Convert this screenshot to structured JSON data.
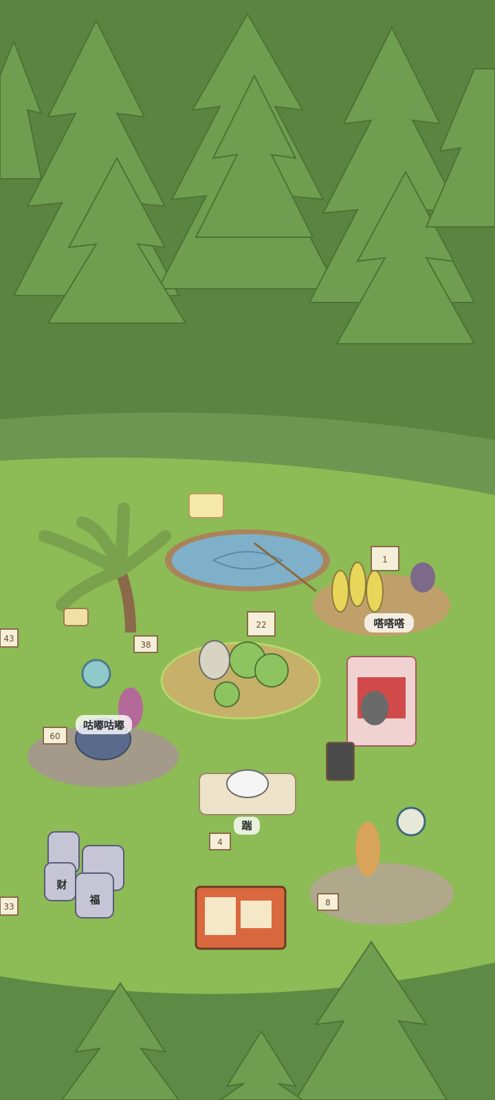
{
  "scene": {
    "name": "forest camp"
  },
  "labels": {
    "station_numbers": [
      "43",
      "38",
      "22",
      "1",
      "60",
      "4",
      "8",
      "33"
    ],
    "sounds": {
      "pot_bubbling": "咕嘟咕嘟",
      "chopping": "嗒嗒嗒",
      "kick": "踹"
    },
    "jars": [
      "财",
      "福"
    ]
  }
}
